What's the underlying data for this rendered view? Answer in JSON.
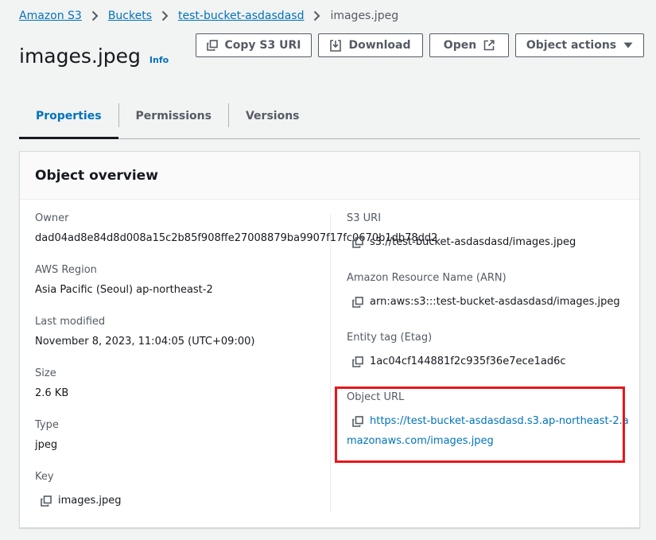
{
  "breadcrumb": {
    "items": [
      "Amazon S3",
      "Buckets",
      "test-bucket-asdasdasd"
    ],
    "current": "images.jpeg"
  },
  "header": {
    "title": "images.jpeg",
    "info": "Info"
  },
  "actions": {
    "copy_s3_uri": "Copy S3 URI",
    "download": "Download",
    "open": "Open",
    "object_actions": "Object actions"
  },
  "tabs": [
    "Properties",
    "Permissions",
    "Versions"
  ],
  "overview": {
    "title": "Object overview",
    "owner_label": "Owner",
    "owner_value": "dad04ad8e84d8d008a15c2b85f908ffe27008879ba9907f17fc0670b1db78dd2",
    "region_label": "AWS Region",
    "region_value": "Asia Pacific (Seoul) ap-northeast-2",
    "modified_label": "Last modified",
    "modified_value": "November 8, 2023, 11:04:05 (UTC+09:00)",
    "size_label": "Size",
    "size_value": "2.6 KB",
    "type_label": "Type",
    "type_value": "jpeg",
    "key_label": "Key",
    "key_value": "images.jpeg",
    "s3uri_label": "S3 URI",
    "s3uri_value": "s3://test-bucket-asdasdasd/images.jpeg",
    "arn_label": "Amazon Resource Name (ARN)",
    "arn_value": "arn:aws:s3:::test-bucket-asdasdasd/images.jpeg",
    "etag_label": "Entity tag (Etag)",
    "etag_value": "1ac04cf144881f2c935f36e7ece1ad6c",
    "url_label": "Object URL",
    "url_line1": "https://test-bucket-asdasdasd.s3.ap-northeast-2.a",
    "url_line2": "mazonaws.com/images.jpeg"
  },
  "colors": {
    "link": "#0073bb",
    "highlight": "#e8161b"
  },
  "icons": [
    "chevron-right-icon",
    "copy-icon",
    "download-icon",
    "external-link-icon",
    "caret-down-icon"
  ]
}
